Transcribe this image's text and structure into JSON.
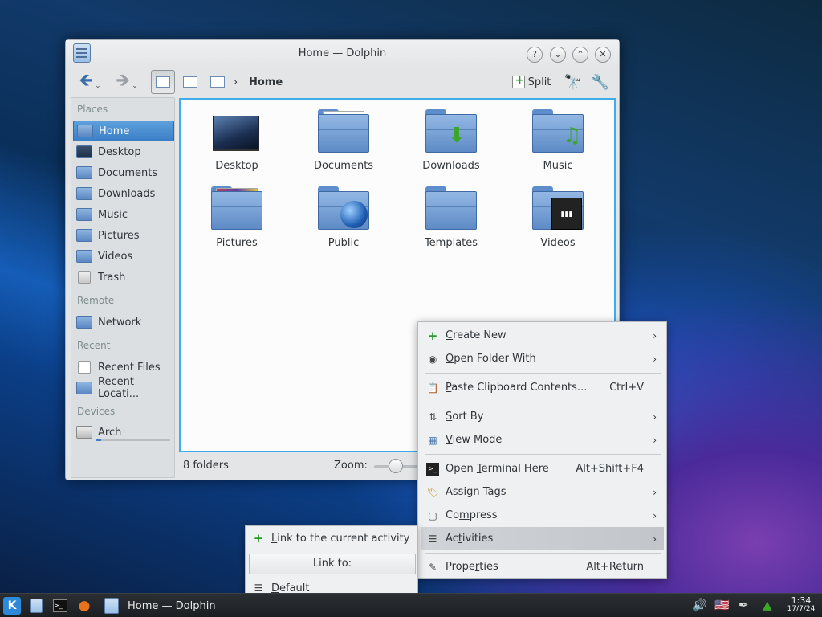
{
  "window": {
    "title": "Home — Dolphin",
    "buttons": {
      "help": "?",
      "minimize": "⌄",
      "maximize": "⌃",
      "close": "✕"
    }
  },
  "toolbar": {
    "back": "🡸",
    "forward": "🡺",
    "breadcrumb_sep": "›",
    "breadcrumb_home": "Home",
    "split_label": "Split"
  },
  "places": {
    "header": "Places",
    "items": [
      {
        "label": "Home",
        "icon": "home-folder-icon"
      },
      {
        "label": "Desktop",
        "icon": "desktop-icon"
      },
      {
        "label": "Documents",
        "icon": "documents-folder-icon"
      },
      {
        "label": "Downloads",
        "icon": "downloads-folder-icon"
      },
      {
        "label": "Music",
        "icon": "music-folder-icon"
      },
      {
        "label": "Pictures",
        "icon": "pictures-folder-icon"
      },
      {
        "label": "Videos",
        "icon": "videos-folder-icon"
      },
      {
        "label": "Trash",
        "icon": "trash-icon"
      }
    ],
    "remote_header": "Remote",
    "network": "Network",
    "recent_header": "Recent",
    "recent_files": "Recent Files",
    "recent_locations": "Recent Locati...",
    "devices_header": "Devices",
    "device": "Arch",
    "device_usage": 0.07
  },
  "files": [
    {
      "name": "Desktop"
    },
    {
      "name": "Documents"
    },
    {
      "name": "Downloads"
    },
    {
      "name": "Music"
    },
    {
      "name": "Pictures"
    },
    {
      "name": "Public"
    },
    {
      "name": "Templates"
    },
    {
      "name": "Videos"
    }
  ],
  "status": {
    "count": "8 folders",
    "zoom_label": "Zoom:"
  },
  "context_menu": {
    "create_new": {
      "u": "C",
      "rest": "reate New"
    },
    "open_with": {
      "u": "O",
      "rest": "pen Folder With"
    },
    "paste": {
      "u": "P",
      "rest": "aste Clipboard Contents...",
      "shortcut": "Ctrl+V"
    },
    "sort_by": {
      "u": "S",
      "rest": "ort By"
    },
    "view_mode": {
      "u": "V",
      "rest": "iew Mode"
    },
    "terminal": {
      "u": "T",
      "pre": "Open ",
      "rest": "erminal Here",
      "shortcut": "Alt+Shift+F4"
    },
    "assign_tags": {
      "u": "A",
      "rest": "ssign Tags"
    },
    "compress": {
      "pre": "Co",
      "u": "m",
      "rest": "press"
    },
    "activities": {
      "pre": "Ac",
      "u": "t",
      "rest": "ivities"
    },
    "properties": {
      "pre": "Prope",
      "u": "r",
      "rest": "ties",
      "shortcut": "Alt+Return"
    },
    "arrow": "›"
  },
  "submenu": {
    "link_current": {
      "u": "L",
      "rest": "ink to the current activity"
    },
    "link_to": "Link to:",
    "default": {
      "u": "D",
      "rest": "efault"
    }
  },
  "taskbar": {
    "task_label": "Home — Dolphin",
    "time": "1:34",
    "date": "17/7/24"
  }
}
